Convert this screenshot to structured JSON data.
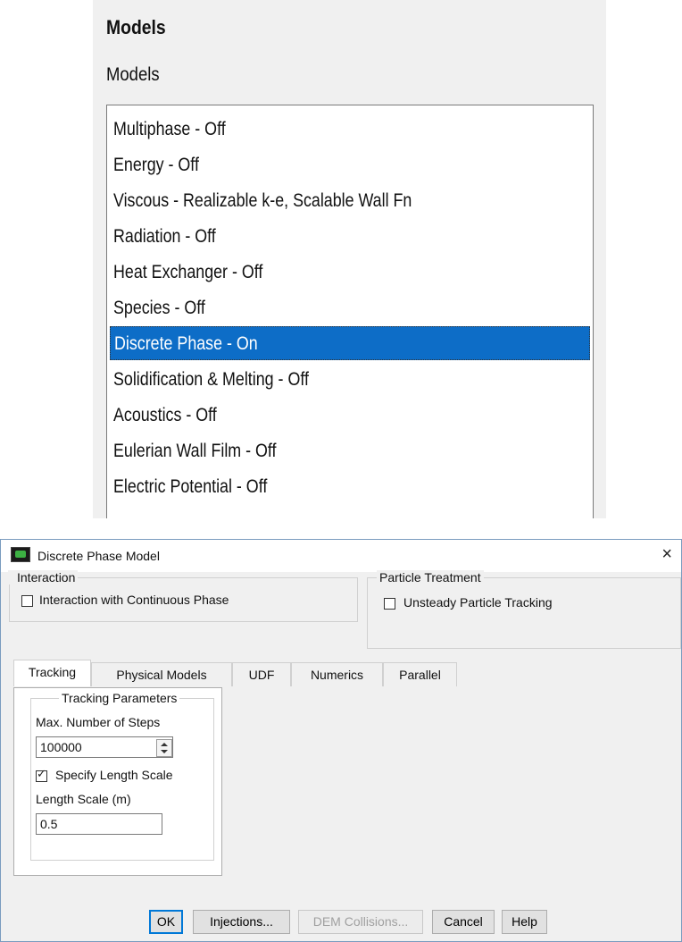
{
  "models_panel": {
    "title": "Models",
    "subtitle": "Models",
    "items": [
      {
        "label": "Multiphase - Off"
      },
      {
        "label": "Energy - Off"
      },
      {
        "label": "Viscous - Realizable k-e, Scalable Wall Fn"
      },
      {
        "label": "Radiation - Off"
      },
      {
        "label": "Heat Exchanger - Off"
      },
      {
        "label": "Species - Off"
      },
      {
        "label": "Discrete Phase - On",
        "selected": true
      },
      {
        "label": "Solidification & Melting - Off"
      },
      {
        "label": "Acoustics - Off"
      },
      {
        "label": "Eulerian Wall Film - Off"
      },
      {
        "label": "Electric Potential - Off"
      }
    ],
    "selected_color": "#0d6dc7"
  },
  "dialog": {
    "title": "Discrete Phase Model",
    "app_icon": "fluent-app-icon",
    "close_icon": "close-icon",
    "close_glyph": "×",
    "interaction": {
      "group_label": "Interaction",
      "checkbox_label": "Interaction with Continuous Phase",
      "checked": false
    },
    "particle_treatment": {
      "group_label": "Particle Treatment",
      "checkbox_label": "Unsteady Particle Tracking",
      "checked": false
    },
    "tabs": [
      {
        "label": "Tracking",
        "active": true
      },
      {
        "label": "Physical Models"
      },
      {
        "label": "UDF"
      },
      {
        "label": "Numerics"
      },
      {
        "label": "Parallel"
      }
    ],
    "tracking": {
      "group_label": "Tracking Parameters",
      "max_steps_label": "Max. Number of Steps",
      "max_steps_value": "100000",
      "specify_length_scale_label": "Specify Length Scale",
      "specify_length_scale_checked": true,
      "length_scale_label": "Length Scale (m)",
      "length_scale_value": "0.5"
    },
    "buttons": {
      "ok": "OK",
      "injections": "Injections...",
      "dem_collisions": "DEM Collisions...",
      "cancel": "Cancel",
      "help": "Help"
    }
  }
}
